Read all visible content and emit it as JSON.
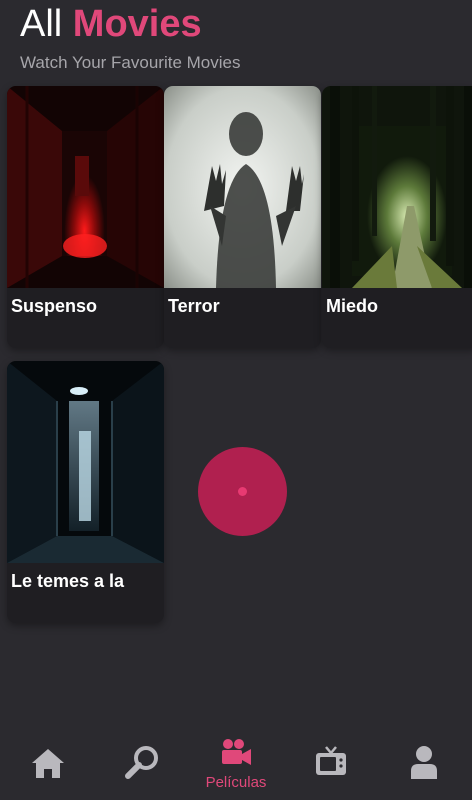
{
  "header": {
    "title_prefix": "All",
    "title_accent": "Movies",
    "subtitle": "Watch Your Favourite Movies"
  },
  "movies": [
    {
      "title": "Suspenso"
    },
    {
      "title": "Terror"
    },
    {
      "title": "Miedo"
    },
    {
      "title": "Le temes a la"
    }
  ],
  "nav": {
    "items": [
      {
        "icon": "home-icon",
        "label": ""
      },
      {
        "icon": "search-icon",
        "label": ""
      },
      {
        "icon": "video-camera-icon",
        "label": "Películas",
        "active": true
      },
      {
        "icon": "tv-icon",
        "label": ""
      },
      {
        "icon": "user-icon",
        "label": ""
      }
    ]
  },
  "colors": {
    "background": "#2b2a2f",
    "accent": "#e0487a",
    "card": "#1f1e22",
    "fab": "#b0204f",
    "nav_icon": "#b9b8bd"
  }
}
